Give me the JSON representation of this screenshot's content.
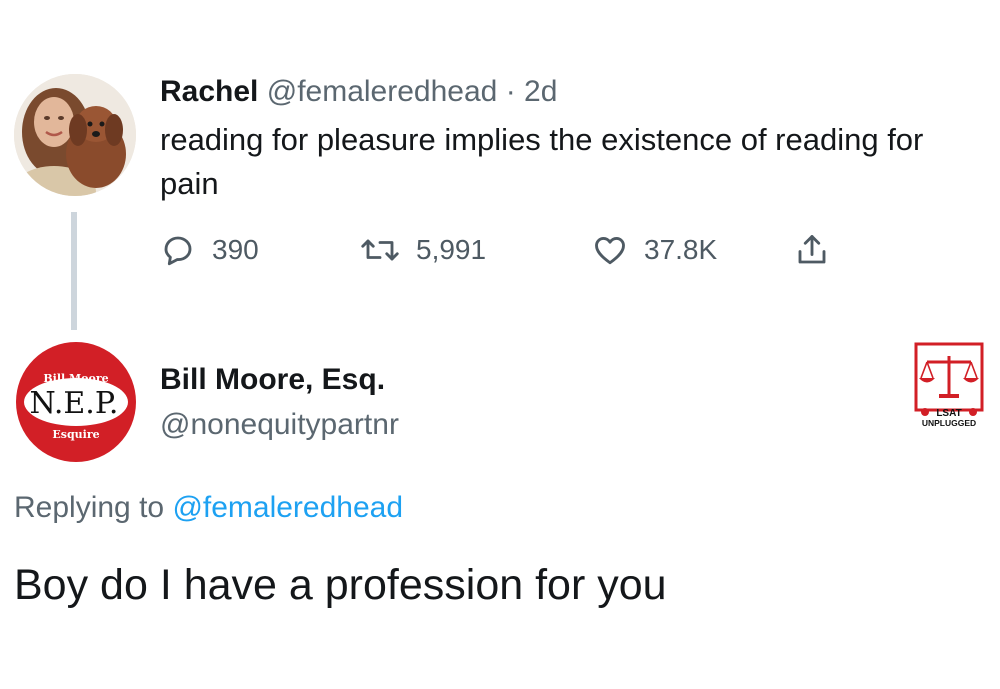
{
  "tweet": {
    "author_name": "Rachel",
    "author_handle": "@femaleredhead",
    "separator": "·",
    "time": "2d",
    "text": "reading for pleasure implies the existence of reading for pain",
    "avatar_icon": "woman-with-dog-avatar",
    "actions": {
      "reply_count": "390",
      "retweet_count": "5,991",
      "like_count": "37.8K"
    }
  },
  "reply": {
    "author_name": "Bill Moore, Esq.",
    "author_handle": "@nonequitypartnr",
    "replying_prefix": "Replying to",
    "replying_to": "@femaleredhead",
    "text": "Boy do I have a profession for you",
    "avatar": {
      "top_text": "Bill Moore",
      "main_text": "N.E.P.",
      "bottom_text": "Esquire"
    }
  },
  "watermark": {
    "line1": "LSAT",
    "line2": "UNPLUGGED"
  },
  "colors": {
    "text": "#14171a",
    "secondary": "#5b6770",
    "link": "#1da1f2",
    "badge_red": "#d21f26",
    "thread_line": "#cdd5dc"
  }
}
